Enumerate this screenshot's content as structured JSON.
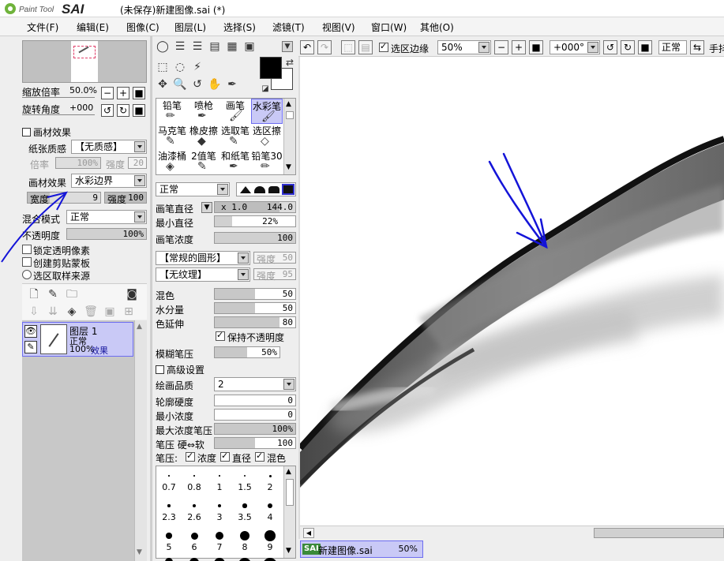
{
  "titlebar": {
    "logo_text": "Paint Tool SAI",
    "title": "(未保存)新建图像.sai (*)"
  },
  "menu": [
    "文件(F)",
    "编辑(E)",
    "图像(C)",
    "图层(L)",
    "选择(S)",
    "滤镜(T)",
    "视图(V)",
    "窗口(W)",
    "其他(O)"
  ],
  "navigator": {
    "zoom_label": "缩放倍率",
    "zoom_value": "50.0%",
    "rotate_label": "旋转角度",
    "rotate_value": "+000",
    "minus": "−",
    "plus": "+",
    "reset": "■"
  },
  "texture": {
    "section": "画材效果",
    "paper_label": "纸张质感",
    "paper_value": "【无质感】",
    "scale_label": "倍率",
    "scale_value": "100%",
    "scale_level": 1.0,
    "strength_label": "强度",
    "strength_value": "20"
  },
  "effect": {
    "label": "画材效果",
    "value": "水彩边界",
    "width_label": "宽度",
    "width_value": "9",
    "width_level": 0.3,
    "strength_label": "强度",
    "strength_value": "100",
    "strength_level": 1.0
  },
  "layer_props": {
    "blend_label": "混合模式",
    "blend_value": "正常",
    "opacity_label": "不透明度",
    "opacity_value": "100%",
    "opacity_level": 1.0,
    "lock_alpha": "锁定透明像素",
    "clip_mask": "创建剪贴蒙板",
    "sample_src": "选区取样来源"
  },
  "layer": {
    "name": "图层 1",
    "mode": "正常",
    "opacity": "100%",
    "effect": "效果"
  },
  "colors": {
    "fg": "#000000",
    "bg": "#ffffff",
    "selected": "#c9c9f6",
    "annotation": "#1414d8"
  },
  "tools": {
    "row1": [
      "铅笔",
      "喷枪",
      "画笔",
      "水彩笔"
    ],
    "row2": [
      "马克笔",
      "橡皮擦",
      "选取笔",
      "选区擦"
    ],
    "row3": [
      "油漆桶",
      "2值笔",
      "和纸笔",
      "铅笔30"
    ]
  },
  "brush": {
    "mode": "正常",
    "size_label": "画笔直径",
    "size_mult": "x 1.0",
    "size_value": "144.0",
    "size_level": 0.8,
    "min_size_label": "最小直径",
    "min_size_value": "22%",
    "min_size_level": 0.22,
    "density_label": "画笔浓度",
    "density_value": "100",
    "density_level": 1.0,
    "shape": "【常规的圆形】",
    "shape_strength_label": "强度",
    "shape_strength_value": "50",
    "texture": "【无纹理】",
    "texture_strength_label": "强度",
    "texture_strength_value": "95",
    "blend_label": "混色",
    "blend_value": "50",
    "blend_level": 0.5,
    "water_label": "水分量",
    "water_value": "50",
    "water_level": 0.5,
    "persist_label": "色延伸",
    "persist_value": "80",
    "persist_level": 0.8,
    "keep_opacity": "保持不透明度",
    "blur_label": "模糊笔压",
    "blur_value": "50%",
    "blur_level": 0.5,
    "advanced": "高级设置",
    "quality_label": "绘画品质",
    "quality_value": "2",
    "edge_label": "轮廓硬度",
    "edge_value": "0",
    "edge_level": 0,
    "min_density_label": "最小浓度",
    "min_density_value": "0",
    "min_density_level": 0,
    "max_density_label": "最大浓度笔压",
    "max_density_value": "100%",
    "max_density_level": 1.0,
    "pressure_label": "笔压 硬⇔软",
    "pressure_value": "100",
    "pressure_level": 1.0,
    "pressure_prefix": "笔压:",
    "pressure_density": "浓度",
    "pressure_size": "直径",
    "pressure_blend": "混色"
  },
  "brush_sizes": [
    "0.7",
    "0.8",
    "1",
    "1.5",
    "2",
    "2.3",
    "2.6",
    "3",
    "3.5",
    "4",
    "5",
    "6",
    "7",
    "8",
    "9"
  ],
  "canvas_toolbar": {
    "select_edge_label": "选区边缘",
    "zoom_value": "50%",
    "angle_value": "+000°",
    "mode_value": "正常",
    "hand_label": "手抖"
  },
  "status": {
    "tab_label": "新建图像.sai",
    "zoom": "50%",
    "badge": "SAI"
  }
}
